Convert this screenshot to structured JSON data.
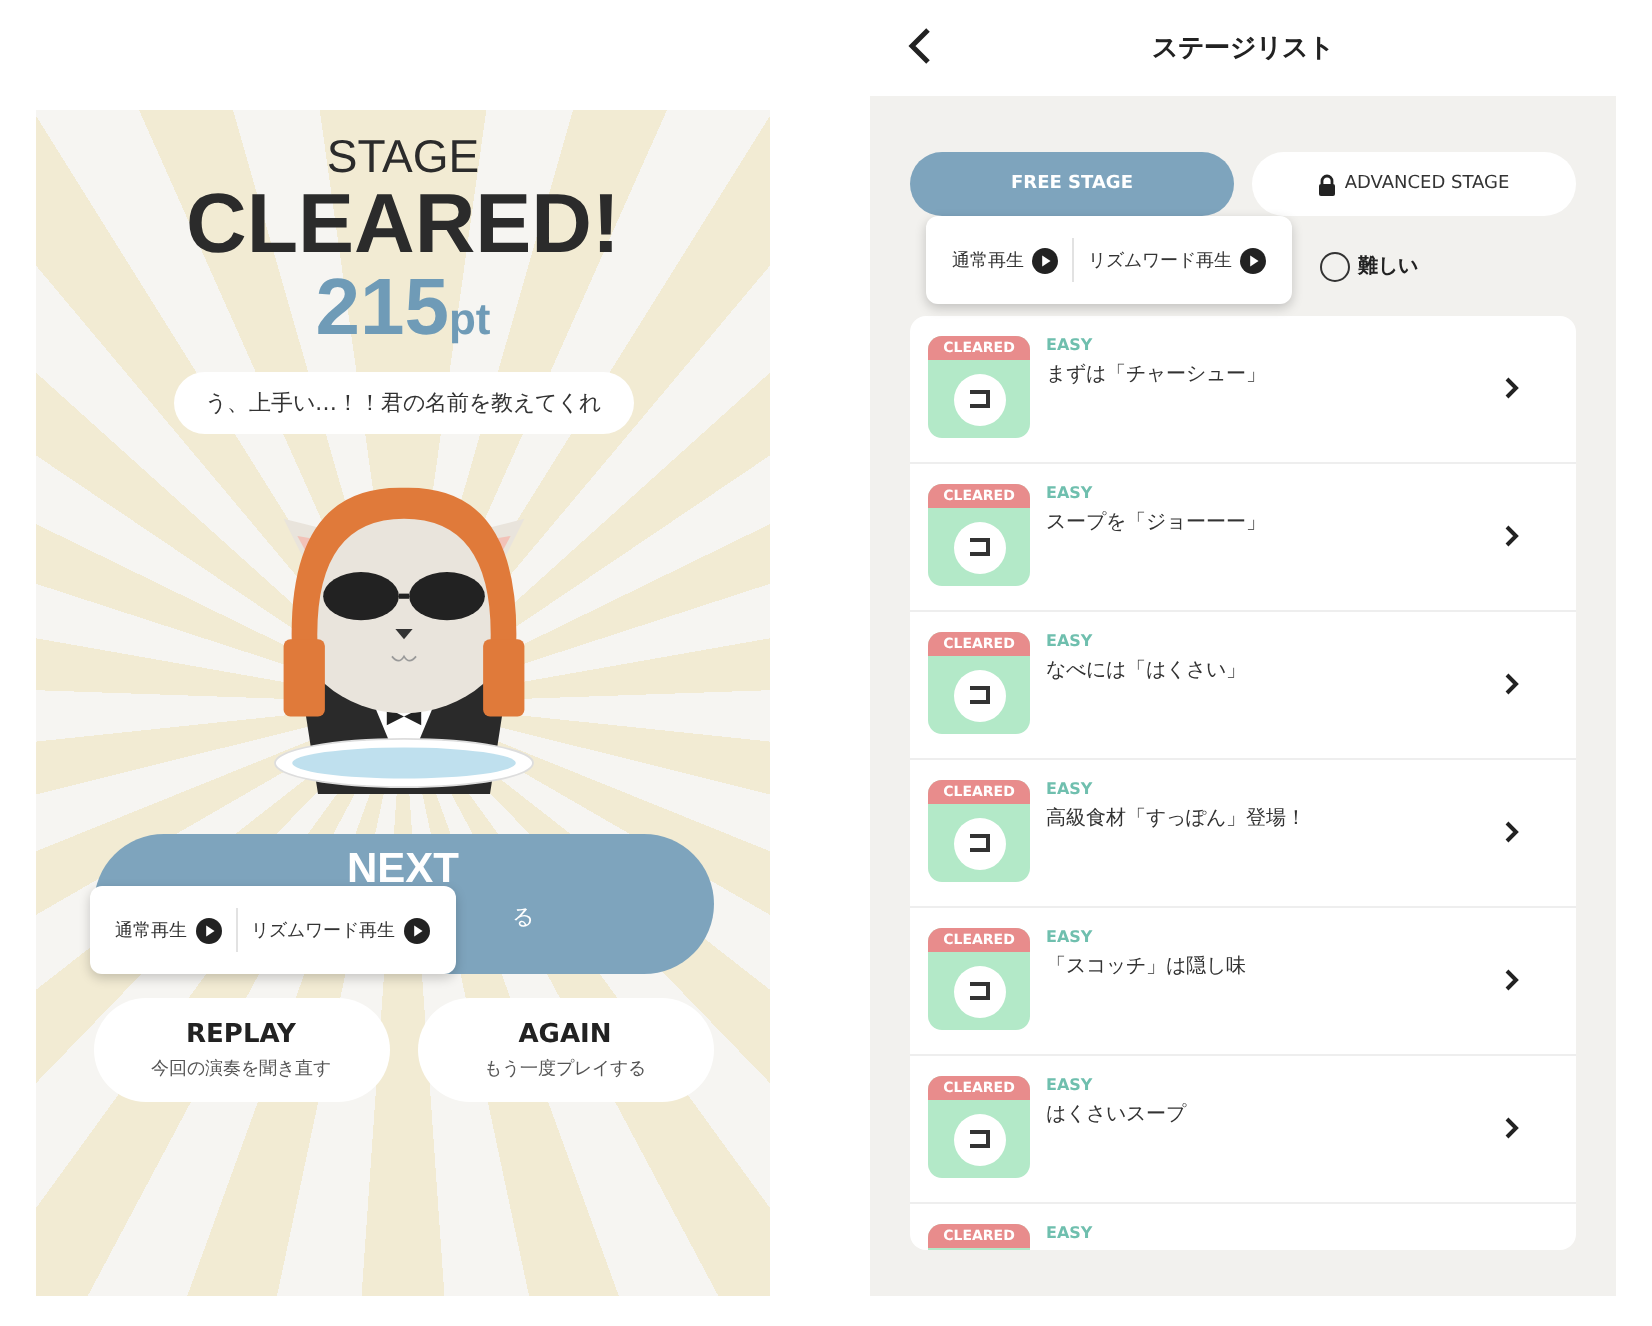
{
  "result_screen": {
    "heading_small": "STAGE",
    "heading": "CLEARED!",
    "score": "215",
    "score_unit": "pt",
    "speech": "う、上手い…！！君の名前を教えてくれ",
    "next_button": {
      "label": "NEXT",
      "sublabel": "る"
    },
    "playback_popup": {
      "options": [
        {
          "label": "通常再生"
        },
        {
          "label": "リズムワード再生"
        }
      ]
    },
    "buttons": [
      {
        "label": "REPLAY",
        "sublabel": "今回の演奏を聞き直す"
      },
      {
        "label": "AGAIN",
        "sublabel": "もう一度プレイする"
      }
    ]
  },
  "stage_list_screen": {
    "title": "ステージリスト",
    "tabs": [
      {
        "label": "FREE STAGE",
        "selected": true,
        "locked": false
      },
      {
        "label": "ADVANCED STAGE",
        "selected": false,
        "locked": true
      }
    ],
    "playback_popup": {
      "options": [
        {
          "label": "通常再生"
        },
        {
          "label": "リズムワード再生"
        }
      ]
    },
    "filter": {
      "label": "難しい",
      "selected": false
    },
    "stages": [
      {
        "badge": "CLEARED",
        "difficulty": "EASY",
        "title": "まずは「チャーシュー」"
      },
      {
        "badge": "CLEARED",
        "difficulty": "EASY",
        "title": "スープを「ジョーーー」"
      },
      {
        "badge": "CLEARED",
        "difficulty": "EASY",
        "title": "なべには「はくさい」"
      },
      {
        "badge": "CLEARED",
        "difficulty": "EASY",
        "title": "高級食材「すっぽん」登場！"
      },
      {
        "badge": "CLEARED",
        "difficulty": "EASY",
        "title": "「スコッチ」は隠し味"
      },
      {
        "badge": "CLEARED",
        "difficulty": "EASY",
        "title": "はくさいスープ"
      },
      {
        "badge": "CLEARED",
        "difficulty": "EASY"
      }
    ]
  }
}
